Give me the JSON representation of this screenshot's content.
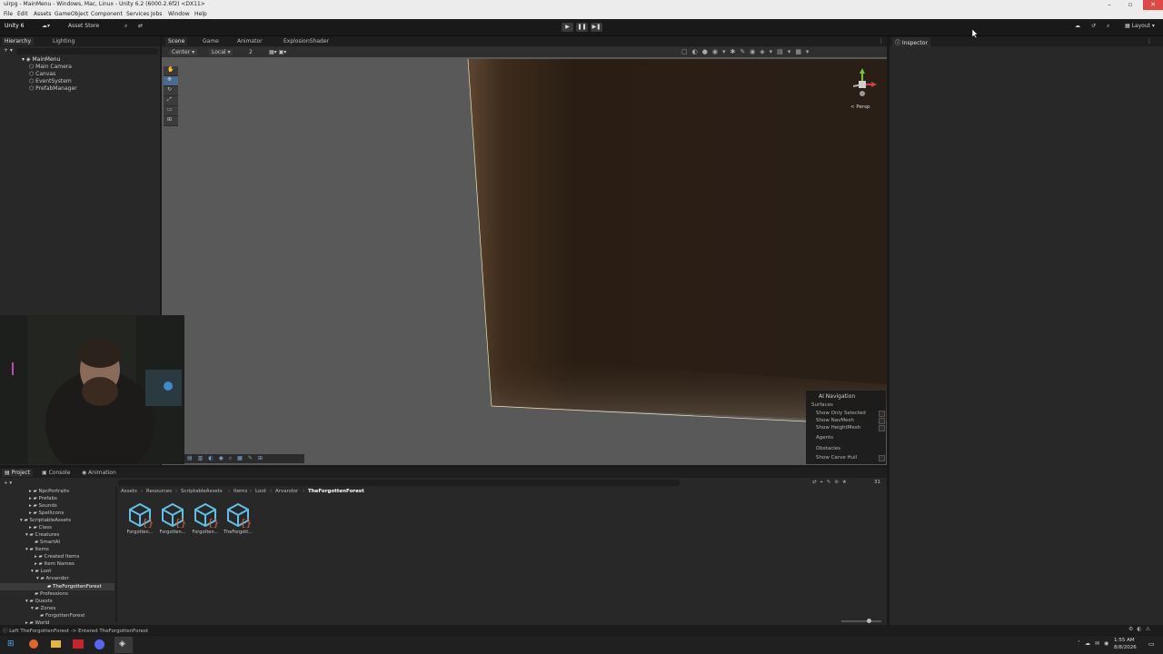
{
  "window": {
    "title": "uirpg - MainMenu - Windows, Mac, Linux - Unity 6.2 (6000.2.6f2) <DX11>",
    "controls": [
      "–",
      "▫",
      "✕"
    ]
  },
  "menu": [
    "File",
    "Edit",
    "Assets",
    "GameObject",
    "Component",
    "Services",
    "Jobs",
    "Window",
    "Help"
  ],
  "toolbar": {
    "unity_label": "Unity 6",
    "asset_store": "Asset Store",
    "layout": "Layout",
    "play": "▶",
    "pause": "❚❚",
    "step": "▶❚"
  },
  "hierarchy": {
    "tabs": [
      "Hierarchy",
      "Lighting"
    ],
    "scene": "MainMenu",
    "items": [
      "Main Camera",
      "Canvas",
      "EventSystem",
      "PrefabManager"
    ]
  },
  "scene_tabs": [
    "Scene",
    "Game",
    "Animator",
    "ExplosionShader"
  ],
  "scene_toolbar": {
    "pivot": "Center",
    "space": "Local",
    "grid": "2"
  },
  "gizmo": {
    "label": "< Persp"
  },
  "ai_nav": {
    "title": "AI Navigation",
    "surfaces": "Surfaces",
    "opt1": "Show Only Selected",
    "opt2": "Show NavMesh",
    "opt3": "Show HeightMesh",
    "agents": "Agents",
    "obstacles": "Obstacles",
    "opt4": "Show Carve Hull"
  },
  "inspector": {
    "tab": "Inspector"
  },
  "project": {
    "tabs": [
      "Project",
      "Console",
      "Animation"
    ],
    "breadcrumb": [
      "Assets",
      "Resources",
      "ScriptableAssets",
      "Items",
      "Loot",
      "Arvandor",
      "TheForgottenForest"
    ],
    "tree": [
      "NpcPortraits",
      "Prefabs",
      "Sounds",
      "Spellicons",
      "ScriptableAssets",
      "Class",
      "Creatures",
      "SmartAI",
      "Items",
      "Created Items",
      "Item Names",
      "Loot",
      "Arvandor",
      "TheForgottenForest",
      "Professions",
      "Quests",
      "Zones",
      "ForgottenForest",
      "World"
    ],
    "assets": [
      "Forgotten...",
      "Forgotten...",
      "Forgotten...",
      "TheForgott..."
    ],
    "count": "31"
  },
  "status": {
    "message": "Left TheForgottenForest -> Entered TheForgottenForest"
  },
  "taskbar": {
    "time": "1:55 AM",
    "date": "8/8/2026"
  },
  "colors": {
    "accent": "#4a9ae0",
    "asset_icon": "#5fc0e8",
    "braces": "#e0603a"
  }
}
